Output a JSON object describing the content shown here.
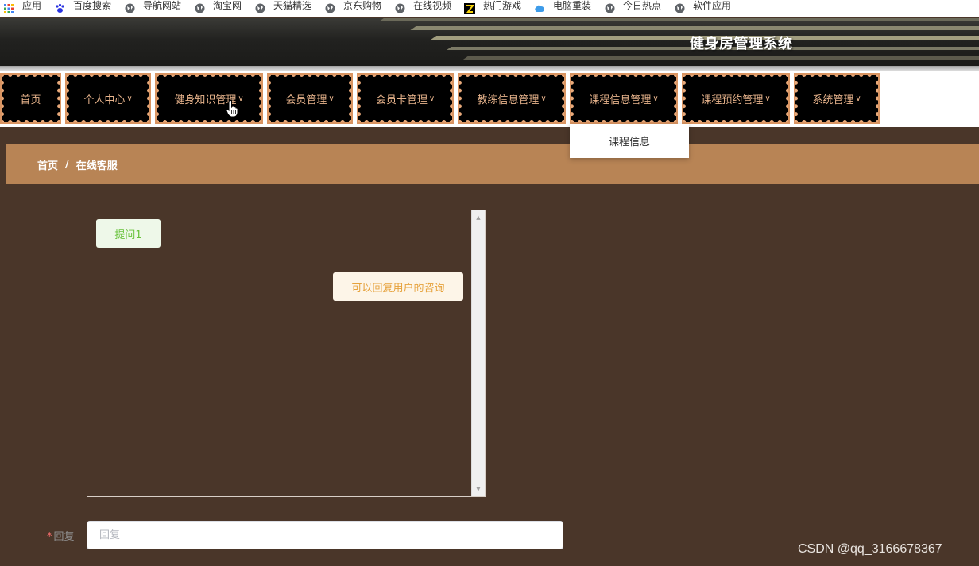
{
  "bookmarks": [
    {
      "label": "应用",
      "icon": "apps-grid-icon"
    },
    {
      "label": "百度搜索",
      "icon": "baidu-paw-icon"
    },
    {
      "label": "导航网站",
      "icon": "globe-icon"
    },
    {
      "label": "淘宝网",
      "icon": "globe-icon"
    },
    {
      "label": "天猫精选",
      "icon": "globe-icon"
    },
    {
      "label": "京东购物",
      "icon": "globe-icon"
    },
    {
      "label": "在线视频",
      "icon": "globe-icon"
    },
    {
      "label": "热门游戏",
      "icon": "game-icon"
    },
    {
      "label": "电脑重装",
      "icon": "cloud-icon"
    },
    {
      "label": "今日热点",
      "icon": "globe-icon"
    },
    {
      "label": "软件应用",
      "icon": "globe-icon"
    }
  ],
  "header": {
    "title": "健身房管理系统"
  },
  "nav": [
    {
      "label": "首页",
      "has_menu": false
    },
    {
      "label": "个人中心",
      "has_menu": true
    },
    {
      "label": "健身知识管理",
      "has_menu": true
    },
    {
      "label": "会员管理",
      "has_menu": true
    },
    {
      "label": "会员卡管理",
      "has_menu": true
    },
    {
      "label": "教练信息管理",
      "has_menu": true
    },
    {
      "label": "课程信息管理",
      "has_menu": true
    },
    {
      "label": "课程预约管理",
      "has_menu": true
    },
    {
      "label": "系统管理",
      "has_menu": true
    }
  ],
  "dropdown": {
    "item": "课程信息"
  },
  "breadcrumb": {
    "home": "首页",
    "separator": "/",
    "current": "在线客服"
  },
  "chat": {
    "question": "提问1",
    "answer": "可以回复用户的咨询"
  },
  "reply": {
    "required_mark": "*",
    "label": "回复",
    "placeholder": "回复",
    "value": ""
  },
  "watermark": "CSDN @qq_3166678367",
  "colors": {
    "page_bg": "#4a3629",
    "breadcrumb_bg": "#b88455",
    "nav_border": "#e8a97a",
    "nav_text": "#e8b48c",
    "question_text": "#67c23a",
    "answer_text": "#e6a23c"
  }
}
